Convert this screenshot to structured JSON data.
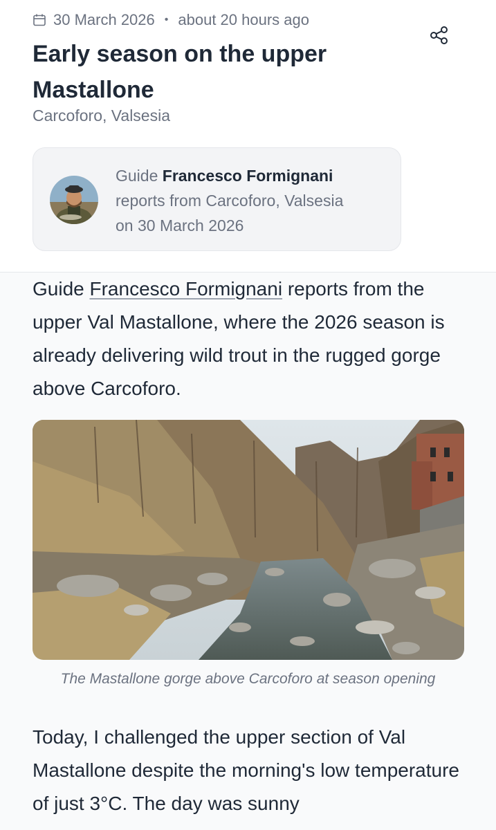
{
  "header": {
    "date": "30 March 2026",
    "relative_time": "about 20 hours ago",
    "separator": "•",
    "title": "Early season on the upper Mastallone",
    "location": "Carcoforo, Valsesia",
    "icons": {
      "calendar": "calendar-icon",
      "share": "share-icon"
    }
  },
  "guide_card": {
    "prefix": "Guide",
    "name": "Francesco Formignani",
    "line2": "reports from Carcoforo, Valsesia",
    "line3": "on 30 March 2026"
  },
  "article": {
    "intro_before": "Guide ",
    "intro_link": "Francesco Formignani",
    "intro_after": " reports from the upper Val Mastallone, where the 2026 season is already delivering wild trout in the rugged gorge above Carcoforo.",
    "image_caption": "The Mastallone gorge above Carcoforo at season opening",
    "body": "Today, I challenged the upper section of Val Mastallone despite the morning's low temperature of just 3°C. The day was sunny"
  },
  "colors": {
    "text": "#1f2937",
    "muted": "#6b7280",
    "card_bg": "#f3f4f6",
    "content_bg": "#f9fafb"
  }
}
